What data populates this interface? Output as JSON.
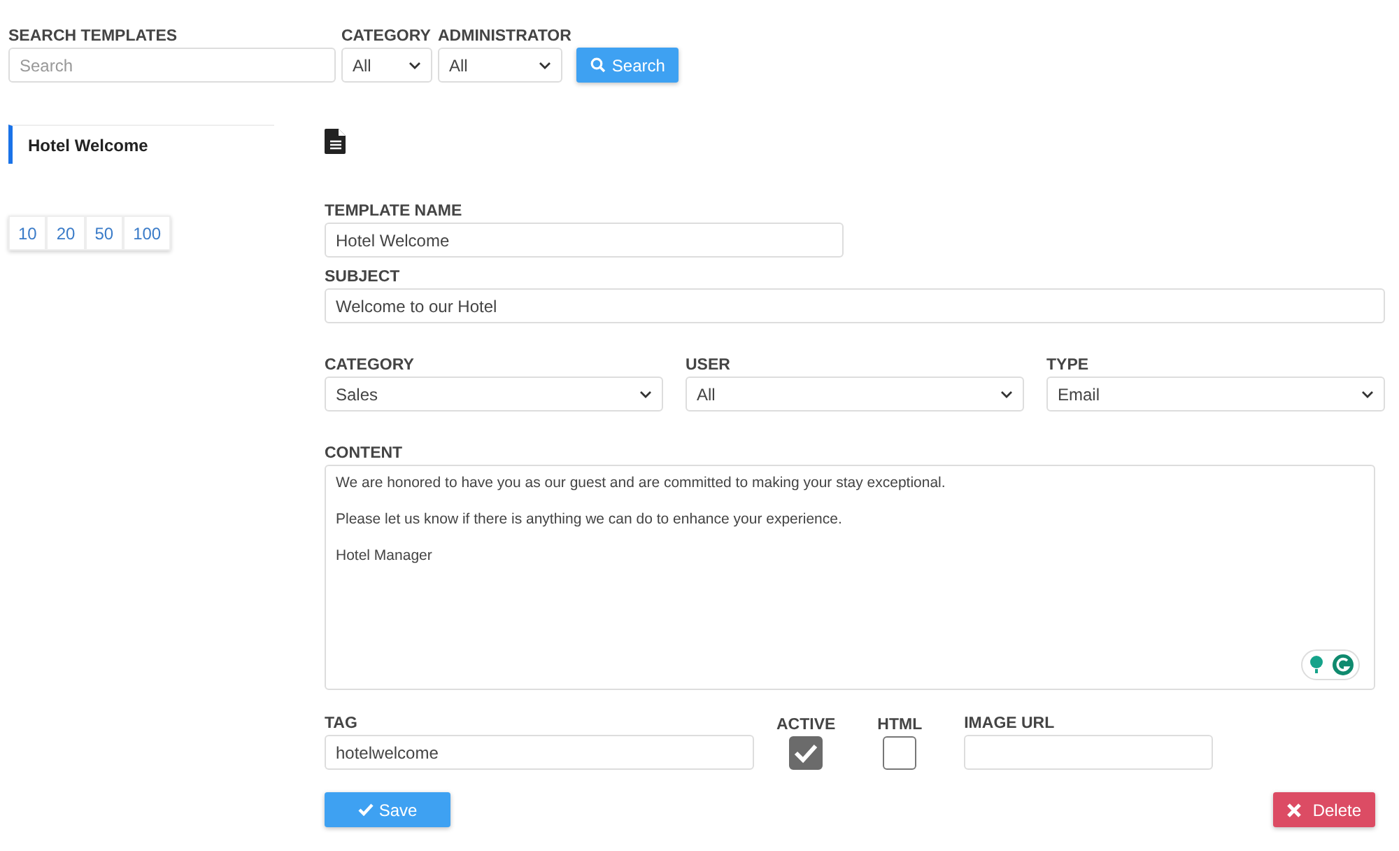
{
  "search_bar": {
    "search_label": "SEARCH TEMPLATES",
    "search_placeholder": "Search",
    "category_label": "CATEGORY",
    "category_value": "All",
    "administrator_label": "ADMINISTRATOR",
    "administrator_value": "All",
    "search_button": "Search"
  },
  "template_list": [
    {
      "label": "Hotel Welcome",
      "selected": true
    }
  ],
  "page_sizes": [
    {
      "label": "10"
    },
    {
      "label": "20"
    },
    {
      "label": "50"
    },
    {
      "label": "100"
    }
  ],
  "form": {
    "template_name_label": "TEMPLATE NAME",
    "template_name": "Hotel Welcome",
    "subject_label": "SUBJECT",
    "subject": "Welcome to our Hotel",
    "selects": [
      {
        "label": "CATEGORY",
        "value": "Sales"
      },
      {
        "label": "USER",
        "value": "All"
      },
      {
        "label": "TYPE",
        "value": "Email"
      }
    ],
    "content_label": "CONTENT",
    "content": [
      "We are honored to have you as our guest and are committed to making your stay exceptional.",
      "Please let us know if there is anything we can do to enhance your experience.",
      "Hotel Manager"
    ],
    "tag_label": "TAG",
    "tag": "hotelwelcome",
    "active_label": "ACTIVE",
    "active": true,
    "html_label": "HTML",
    "html": false,
    "image_url_label": "IMAGE URL",
    "save_button": "Save",
    "delete_button": "Delete"
  }
}
